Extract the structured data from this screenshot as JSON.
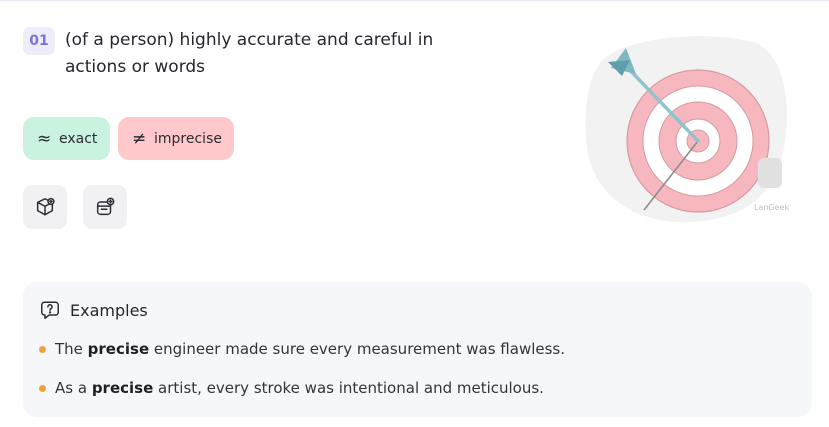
{
  "definition": {
    "number": "01",
    "text": "(of a person) highly accurate and careful in actions or words"
  },
  "synonym": {
    "symbol": "≈",
    "word": "exact"
  },
  "antonym": {
    "symbol": "≠",
    "word": "imprecise"
  },
  "illustration": {
    "watermark": "LanGeek"
  },
  "examples": {
    "title": "Examples",
    "items": [
      {
        "before": "The ",
        "keyword": "precise",
        "after": " engineer made sure every measurement was flawless."
      },
      {
        "before": "As a ",
        "keyword": "precise",
        "after": " artist, every stroke was intentional and meticulous."
      }
    ]
  },
  "colors": {
    "synonym_bg": "#c9f3df",
    "antonym_bg": "#ffc9cb",
    "number_accent": "#7a73d9",
    "bullet": "#f2a13a"
  },
  "icons": [
    "cube-icon",
    "flashcard-add-icon",
    "question-bubble-icon",
    "target-arrow-illustration"
  ]
}
